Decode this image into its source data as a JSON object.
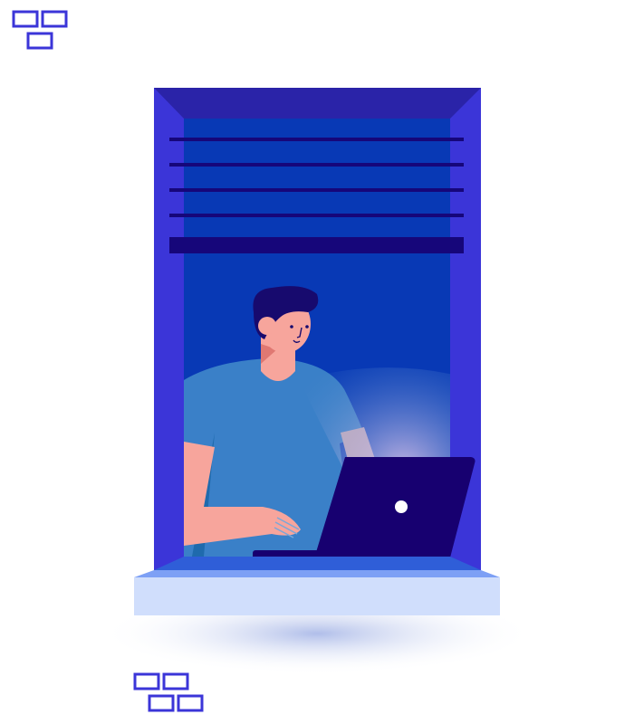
{
  "illustration": {
    "subject": "person-with-laptop-in-window",
    "colors": {
      "frame": "#3b35d8",
      "frame_top": "#2a23a8",
      "window_inner": "#0839b5",
      "blinds": "#16067a",
      "sill_top": "#7da0f5",
      "sill": "#d0defc",
      "shirt": "#3a80c8",
      "skin": "#f7a59c",
      "hair": "#170a6e",
      "laptop": "#170070"
    }
  }
}
